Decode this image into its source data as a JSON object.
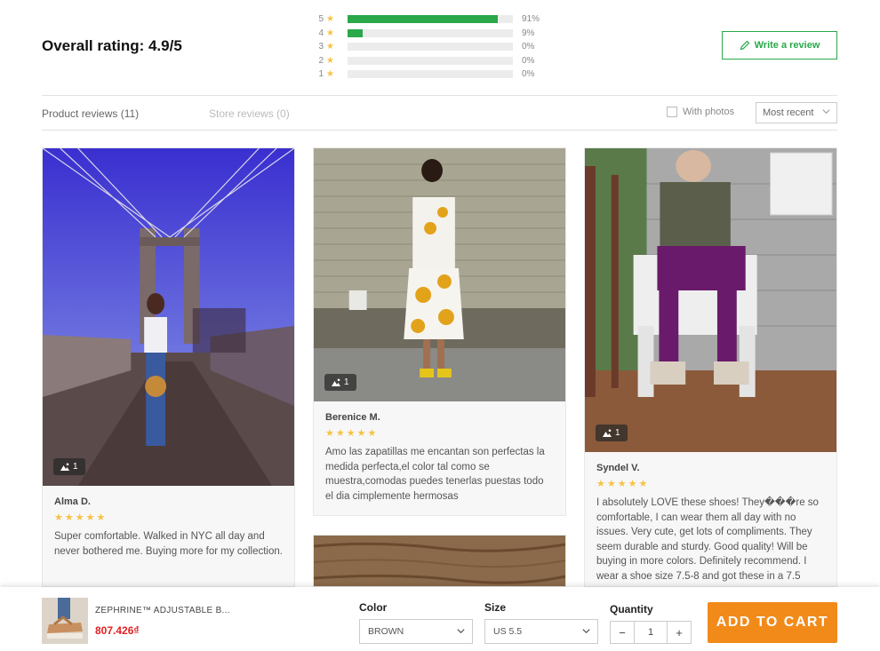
{
  "rating": {
    "overall_label": "Overall rating: 4.9/5",
    "distribution": [
      {
        "stars": "5",
        "percent": 91,
        "label": "91%"
      },
      {
        "stars": "4",
        "percent": 9,
        "label": "9%"
      },
      {
        "stars": "3",
        "percent": 0,
        "label": "0%"
      },
      {
        "stars": "2",
        "percent": 0,
        "label": "0%"
      },
      {
        "stars": "1",
        "percent": 0,
        "label": "0%"
      }
    ],
    "star_glyph": "★",
    "bar_color": "#2aa84a",
    "write_review_label": "Write a review"
  },
  "tabs": {
    "product_reviews": "Product reviews (11)",
    "store_reviews": "Store reviews (0)"
  },
  "filters": {
    "with_photos_label": "With photos",
    "with_photos_checked": false,
    "sort_value": "Most recent"
  },
  "reviews": [
    {
      "name": "Alma D.",
      "stars": "★★★★★",
      "photo_count": "1",
      "text": "Super comfortable. Walked in NYC all day and never bothered me. Buying more for my collection."
    },
    {
      "name": "Berenice M.",
      "stars": "★★★★★",
      "photo_count": "1",
      "text": "Amo las zapatillas me encantan son perfectas la medida perfecta,el color tal como se muestra,comodas puedes tenerlas puestas todo el dia cimplemente hermosas"
    },
    {
      "name": "Syndel V.",
      "stars": "★★★★★",
      "photo_count": "1",
      "text": "I absolutely LOVE these shoes! They���re so comfortable, I can wear them all day with no issues. Very cute, get lots of compliments. They seem durable and sturdy. Good quality! Will be buying in more colors. Definitely recommend. I wear a shoe size 7.5-8 and got these in a 7.5"
    }
  ],
  "cart_bar": {
    "product_name": "ZEPHRINE™ ADJUSTABLE B...",
    "price": "807.426₫",
    "color_label": "Color",
    "color_value": "BROWN",
    "size_label": "Size",
    "size_value": "US 5.5",
    "quantity_label": "Quantity",
    "quantity_value": "1",
    "minus": "−",
    "plus": "+",
    "add_to_cart_label": "ADD TO CART",
    "accent_color": "#f28a1a",
    "price_color": "#e02020"
  },
  "icons": {
    "write": "pencil-icon",
    "chevron": "chevron-down-icon",
    "photo": "image-icon"
  }
}
